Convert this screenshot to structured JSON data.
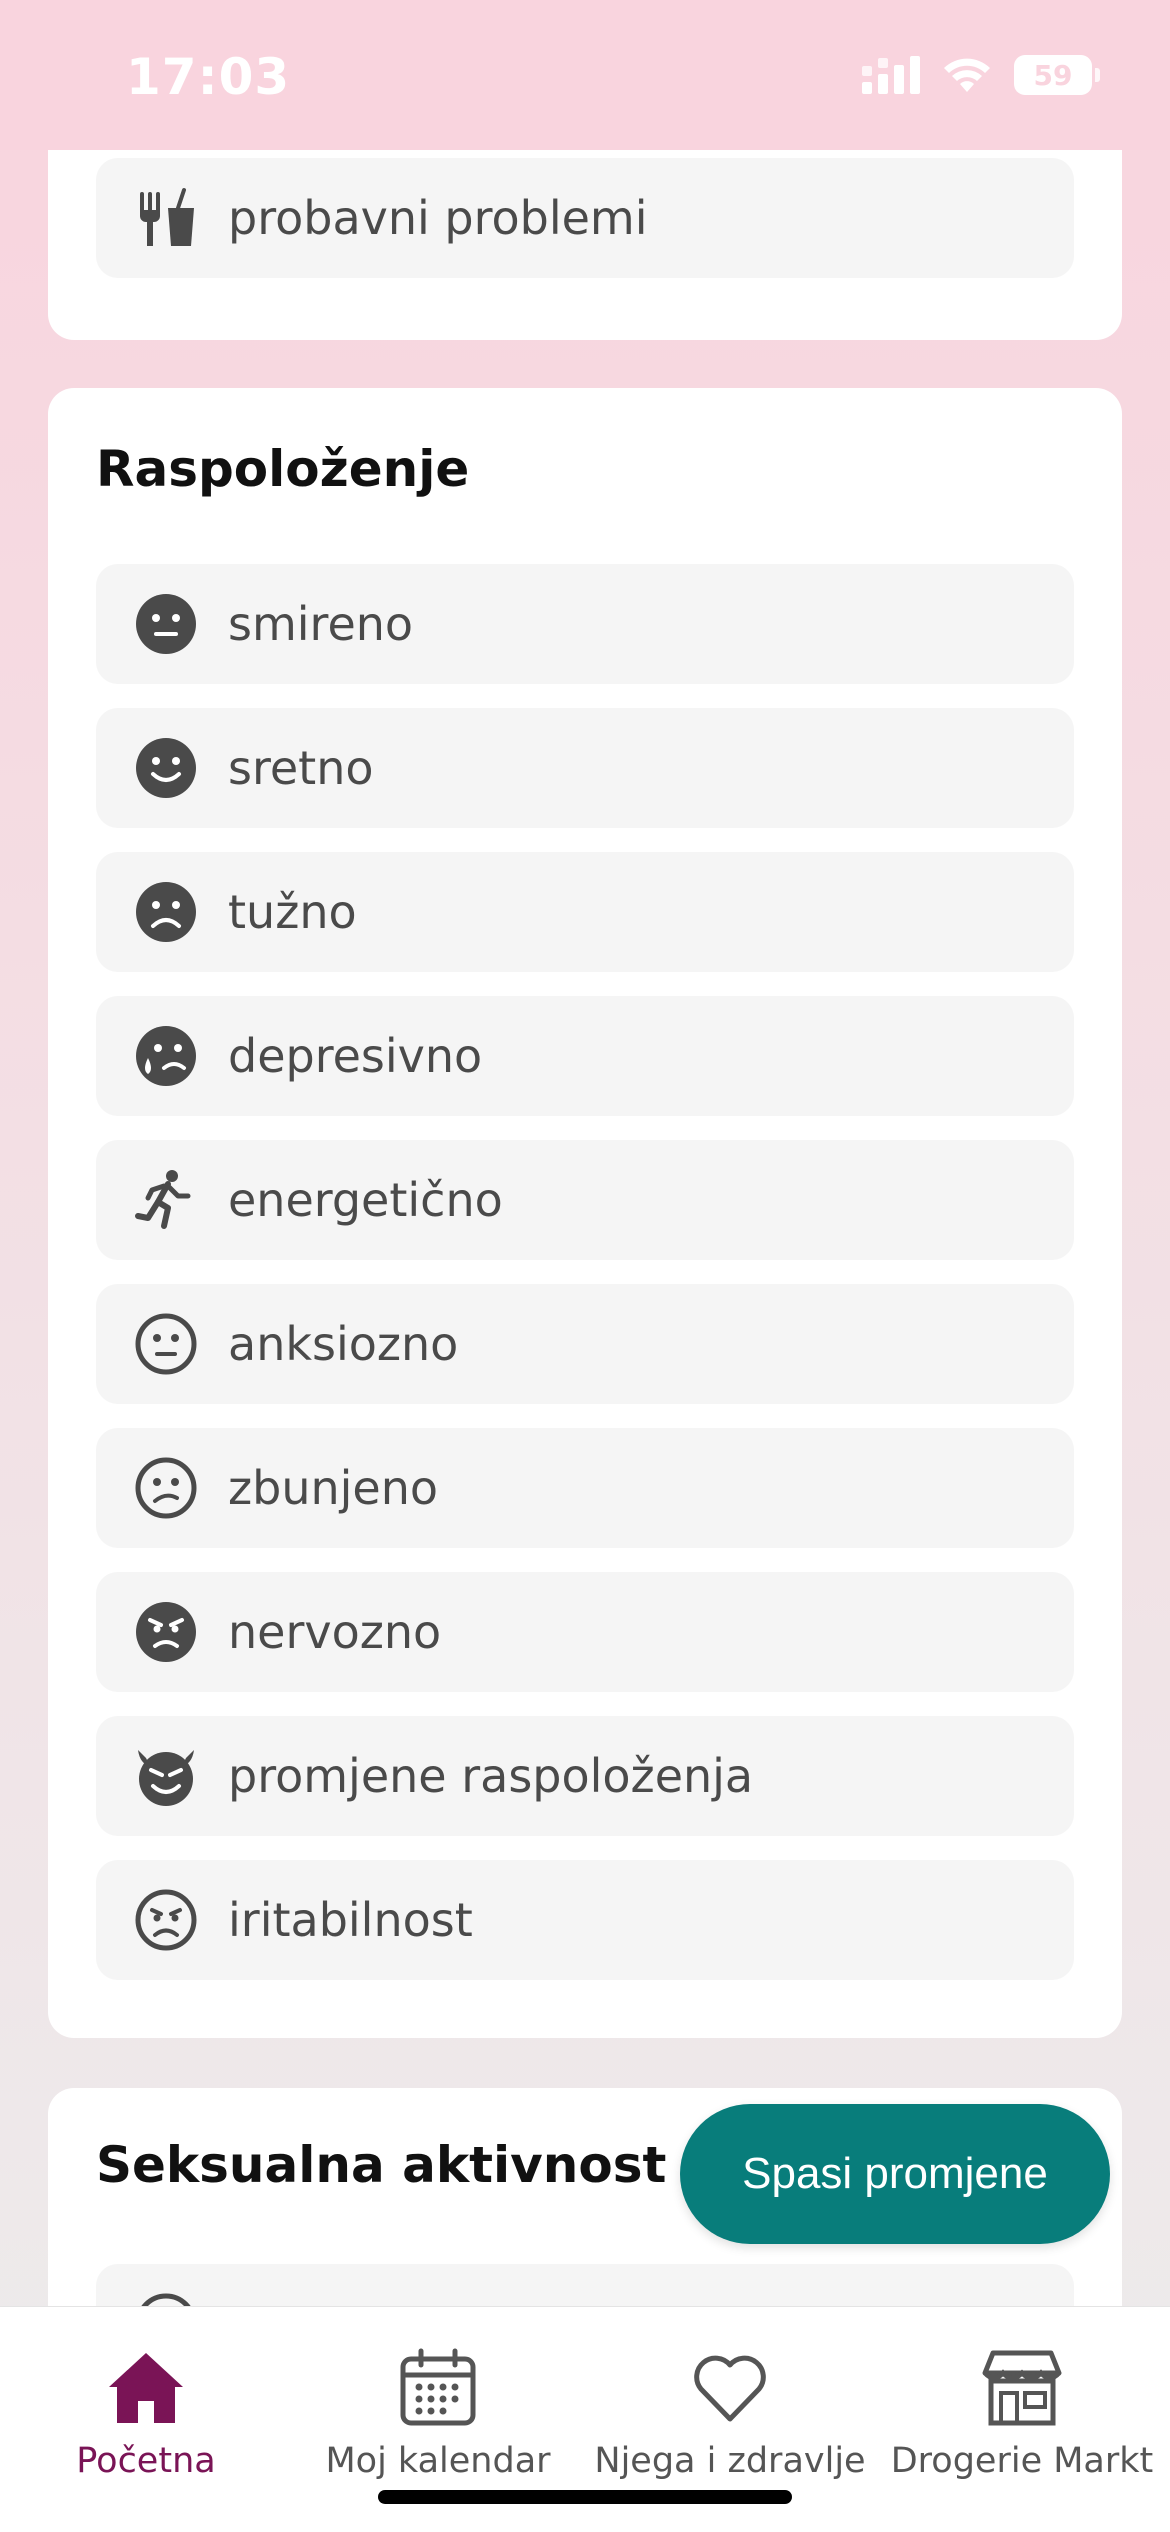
{
  "status_bar": {
    "time": "17:03",
    "battery": "59"
  },
  "top_card": {
    "item": {
      "label": "probavni problemi",
      "icon": "utensils-cup-icon"
    }
  },
  "mood": {
    "title": "Raspoloženje",
    "items": [
      {
        "label": "smireno",
        "icon": "neutral-face-filled-icon"
      },
      {
        "label": "sretno",
        "icon": "smile-face-filled-icon"
      },
      {
        "label": "tužno",
        "icon": "sad-face-filled-icon"
      },
      {
        "label": "depresivno",
        "icon": "crying-face-filled-icon"
      },
      {
        "label": "energetično",
        "icon": "running-person-icon"
      },
      {
        "label": "anksiozno",
        "icon": "neutral-face-outline-icon"
      },
      {
        "label": "zbunjeno",
        "icon": "confused-face-outline-icon"
      },
      {
        "label": "nervozno",
        "icon": "angry-face-filled-icon"
      },
      {
        "label": "promjene raspoloženja",
        "icon": "devil-face-icon"
      },
      {
        "label": "iritabilnost",
        "icon": "frown-face-outline-icon"
      }
    ]
  },
  "sexual_activity": {
    "title": "Seksualna aktivnost"
  },
  "save_button": {
    "label": "Spasi promjene",
    "color": "#087d7b"
  },
  "bottom_nav": {
    "items": [
      {
        "label": "Početna",
        "icon": "home-icon",
        "active": true
      },
      {
        "label": "Moj kalendar",
        "icon": "calendar-icon",
        "active": false
      },
      {
        "label": "Njega i zdravlje",
        "icon": "heart-icon",
        "active": false
      },
      {
        "label": "Drogerie Markt",
        "icon": "store-icon",
        "active": false
      }
    ],
    "active_color": "#7a1456"
  },
  "colors": {
    "header_pink": "#f9d4de",
    "icon_gray": "#4a4a4a"
  }
}
